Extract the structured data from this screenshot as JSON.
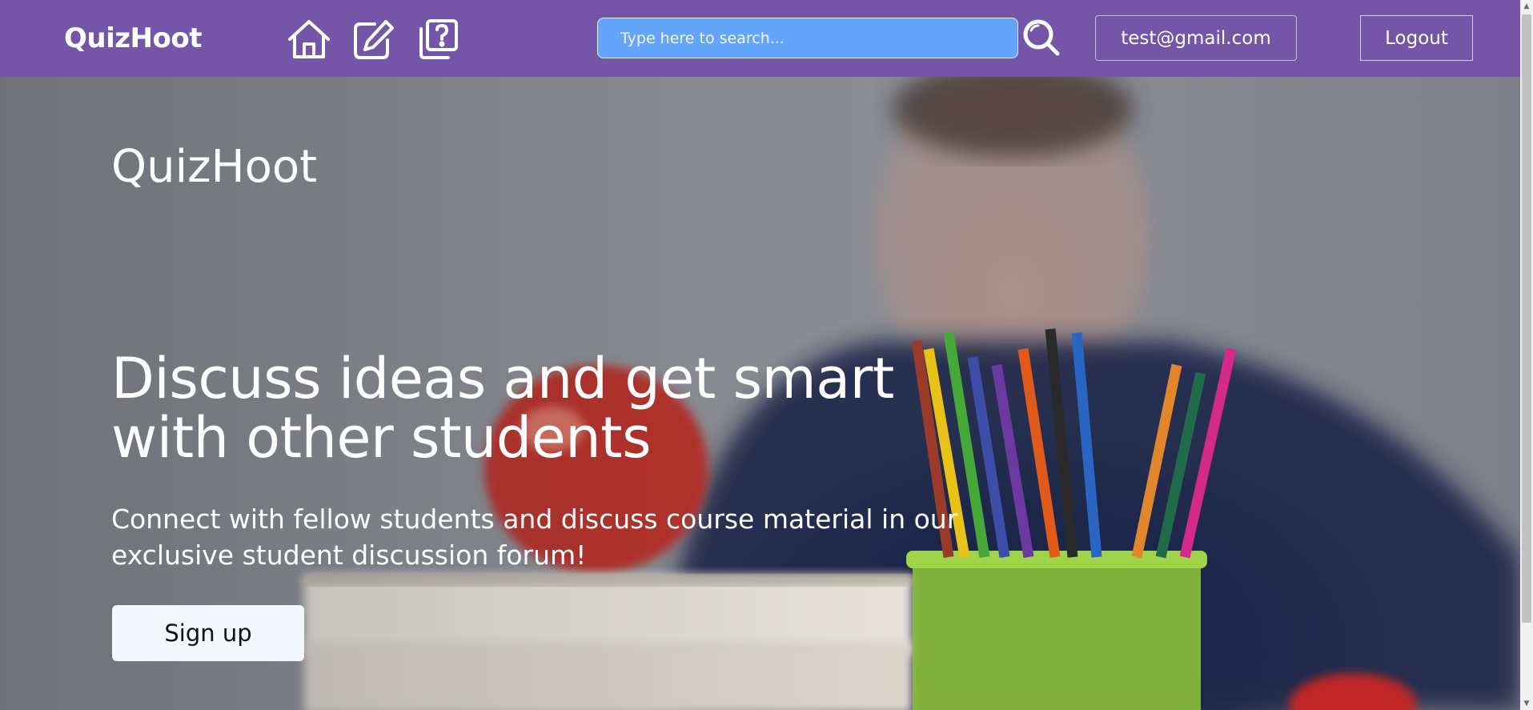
{
  "navbar": {
    "brand": "QuizHoot",
    "icons": [
      "home-icon",
      "edit-icon",
      "questions-icon"
    ],
    "search": {
      "placeholder": "Type here to search...",
      "value": ""
    },
    "user_email": "test@gmail.com",
    "logout_label": "Logout",
    "background": "#7455a8",
    "search_background": "#63a5fb"
  },
  "hero": {
    "title": "QuizHoot",
    "headline": "Discuss ideas and get smart with other students",
    "subtext": "Connect with fellow students and discuss course material in our exclusive student discussion forum!",
    "signup_label": "Sign up"
  }
}
